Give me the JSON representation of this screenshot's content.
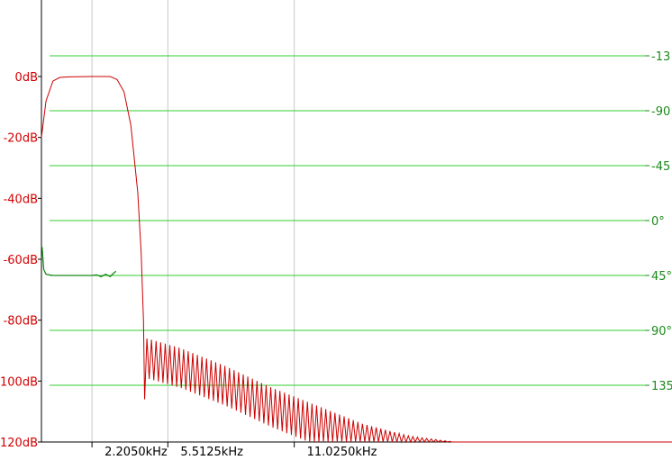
{
  "chart_data": {
    "type": "line",
    "magnitude_axis": {
      "unit": "dB",
      "ticks": [
        {
          "value": 0,
          "label": "0dB"
        },
        {
          "value": -20,
          "label": "-20dB"
        },
        {
          "value": -40,
          "label": "-40dB"
        },
        {
          "value": -60,
          "label": "-60dB"
        },
        {
          "value": -80,
          "label": "-80dB"
        },
        {
          "value": -100,
          "label": "-100dB"
        },
        {
          "value": -120,
          "label": "-120dB"
        }
      ],
      "range": [
        -120,
        12
      ],
      "color": "#d40000"
    },
    "phase_axis": {
      "unit": "degrees",
      "ticks": [
        {
          "value": -135,
          "label": "-13"
        },
        {
          "value": -90,
          "label": "-90"
        },
        {
          "value": -45,
          "label": "-45"
        },
        {
          "value": 0,
          "label": "0°"
        },
        {
          "value": 45,
          "label": "45°"
        },
        {
          "value": 90,
          "label": "90°"
        },
        {
          "value": 135,
          "label": "135"
        }
      ],
      "gridlines": true,
      "grid_color": "#33cc33",
      "color": "#1a8a1a"
    },
    "frequency_axis": {
      "unit": "kHz",
      "range_khz": [
        0,
        27.5
      ],
      "ticks": [
        {
          "value": 2.205,
          "label": "2.2050kHz"
        },
        {
          "value": 5.5125,
          "label": "5.5125kHz"
        },
        {
          "value": 11.025,
          "label": "11.0250kHz"
        }
      ],
      "gridlines": true
    },
    "series": [
      {
        "kind": "magnitude",
        "color": "#cc0000",
        "passband_edge_khz": 2.7,
        "stopband_start_khz": 4.5,
        "points": [
          [
            0.0,
            -20
          ],
          [
            0.2,
            -8
          ],
          [
            0.5,
            -1.5
          ],
          [
            0.8,
            -0.3
          ],
          [
            1.2,
            -0.1
          ],
          [
            2.2,
            0
          ],
          [
            3.0,
            0
          ],
          [
            3.3,
            -1
          ],
          [
            3.6,
            -5
          ],
          [
            3.9,
            -16
          ],
          [
            4.2,
            -38
          ],
          [
            4.35,
            -58
          ],
          [
            4.45,
            -80
          ],
          [
            4.5,
            -106
          ]
        ],
        "sidelobe_peaks": [
          [
            4.6,
            -86
          ],
          [
            6.0,
            -89
          ],
          [
            8.0,
            -95
          ],
          [
            10.0,
            -102
          ],
          [
            12.0,
            -108
          ],
          [
            14.0,
            -114
          ],
          [
            16.0,
            -118
          ],
          [
            18.0,
            -120
          ]
        ]
      },
      {
        "kind": "phase",
        "color": "#1a8a1a",
        "points": [
          [
            0.0,
            21
          ],
          [
            0.03,
            22
          ],
          [
            0.1,
            40
          ],
          [
            0.2,
            44
          ],
          [
            0.5,
            45
          ],
          [
            1.2,
            45
          ],
          [
            2.2,
            45
          ],
          [
            2.4,
            44.5
          ],
          [
            2.6,
            46
          ],
          [
            2.8,
            44
          ],
          [
            3.0,
            46
          ],
          [
            3.1,
            44
          ],
          [
            3.25,
            41.5
          ]
        ]
      }
    ]
  }
}
